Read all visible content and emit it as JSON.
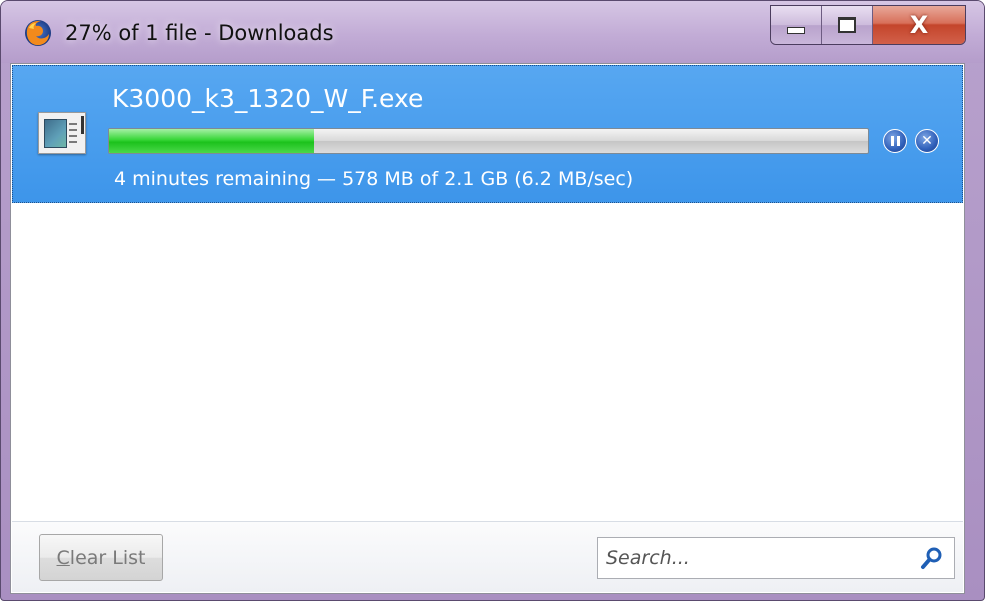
{
  "window": {
    "title": "27% of 1 file - Downloads",
    "app_icon": "firefox-icon",
    "controls": {
      "minimize_icon": "minimize-icon",
      "maximize_icon": "maximize-icon",
      "close_label": "X"
    }
  },
  "downloads": {
    "items": [
      {
        "file_name": "K3000_k3_1320_W_F.exe",
        "file_icon": "executable-file-icon",
        "progress_percent": 27,
        "status": "4 minutes remaining — 578 MB of 2.1 GB (6.2 MB/sec)",
        "pause_icon": "pause-icon",
        "cancel_label": "✕",
        "selected": true
      }
    ]
  },
  "footer": {
    "clear_list_accesskey": "C",
    "clear_list_rest": "lear List",
    "search": {
      "value": "",
      "placeholder": "Search...",
      "icon": "magnifier-icon"
    }
  },
  "colors": {
    "selection": "#3d95ea",
    "progress_fill": "#22c822",
    "title_bar": "#c2acd6",
    "close_button": "#c4452b"
  }
}
